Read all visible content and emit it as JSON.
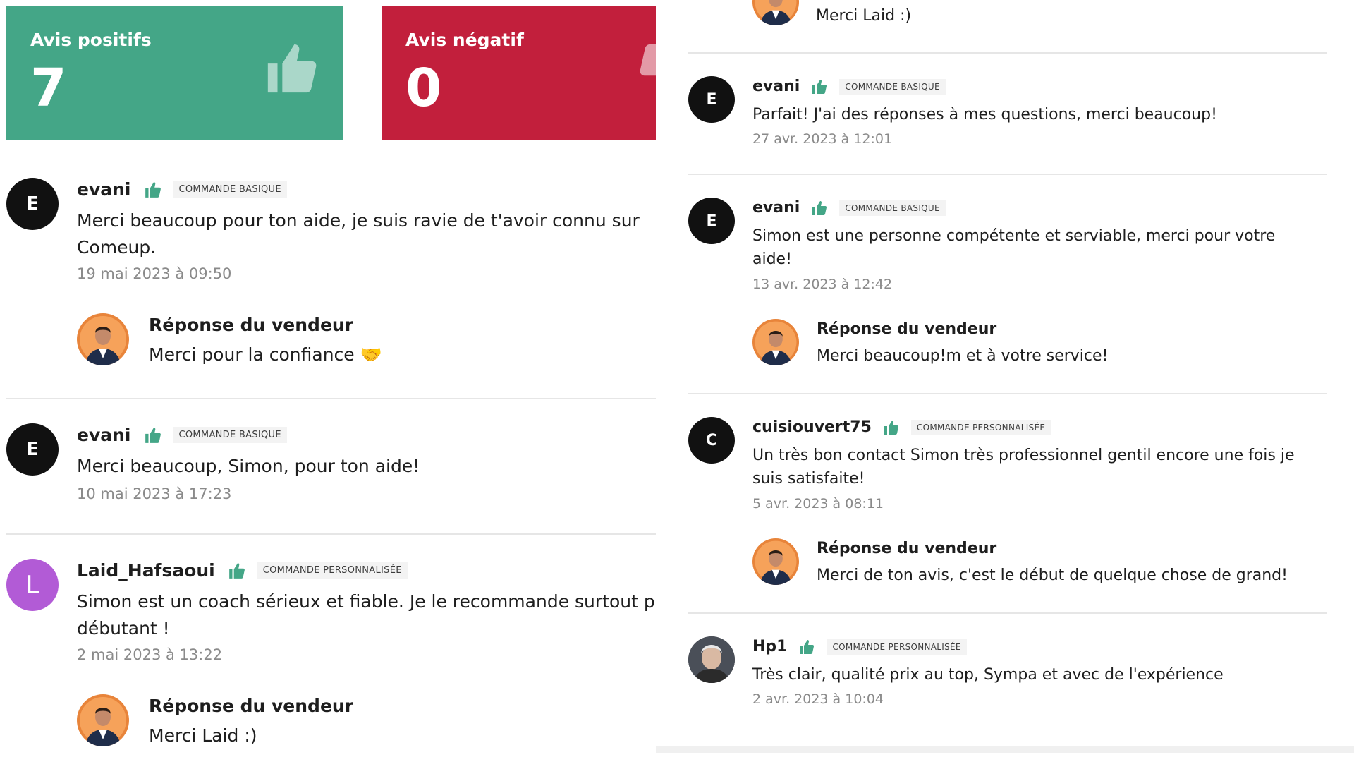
{
  "stats": {
    "positive": {
      "label": "Avis positifs",
      "value": "7"
    },
    "negative": {
      "label": "Avis négatif",
      "value": "0"
    }
  },
  "left_reviews": [
    {
      "avatar_letter": "E",
      "username": "evani",
      "badge": "COMMANDE BASIQUE",
      "text": "Merci beaucoup pour ton aide, je suis ravie de t'avoir connu sur Comeup.",
      "date": "19 mai 2023 à 09:50",
      "reply": {
        "title": "Réponse du vendeur",
        "message": "Merci pour la confiance 🤝"
      }
    },
    {
      "avatar_letter": "E",
      "username": "evani",
      "badge": "COMMANDE BASIQUE",
      "text": "Merci beaucoup, Simon, pour ton aide!",
      "date": "10 mai 2023 à 17:23"
    },
    {
      "avatar_letter": "L",
      "username": "Laid_Hafsaoui",
      "badge": "COMMANDE PERSONNALISÉE",
      "text": "Simon est un coach sérieux et fiable. Je le recommande surtout p",
      "text2": "débutant !",
      "date": "2 mai 2023 à 13:22",
      "reply": {
        "title": "Réponse du vendeur",
        "message": "Merci Laid :)"
      }
    }
  ],
  "right_top_reply": {
    "message": "Merci Laid :)"
  },
  "right_reviews": [
    {
      "avatar_letter": "E",
      "username": "evani",
      "badge": "COMMANDE BASIQUE",
      "text": "Parfait! J'ai des réponses à mes questions, merci beaucoup!",
      "date": "27 avr. 2023 à 12:01"
    },
    {
      "avatar_letter": "E",
      "username": "evani",
      "badge": "COMMANDE BASIQUE",
      "text": "Simon est une personne compétente et serviable, merci pour votre aide!",
      "date": "13 avr. 2023 à 12:42",
      "reply": {
        "title": "Réponse du vendeur",
        "message": "Merci beaucoup!m et à votre service!"
      }
    },
    {
      "avatar_letter": "C",
      "username": "cuisiouvert75",
      "badge": "COMMANDE PERSONNALISÉE",
      "text": "Un très bon contact Simon très professionnel gentil encore une fois je suis satisfaite!",
      "date": "5 avr. 2023 à 08:11",
      "reply": {
        "title": "Réponse du vendeur",
        "message": "Merci de ton avis, c'est le début de quelque chose de grand!"
      }
    },
    {
      "username": "Hp1",
      "badge": "COMMANDE PERSONNALISÉE",
      "text": "Très clair, qualité prix au top, Sympa et avec de l'expérience",
      "date": "2 avr. 2023 à 10:04"
    }
  ],
  "colors": {
    "positive": "#44a687",
    "negative": "#c21f3c",
    "thumb": "#44a687",
    "seller_avatar_bg": "#e8843a"
  },
  "icons": {
    "thumb": "thumbs-up-icon"
  }
}
